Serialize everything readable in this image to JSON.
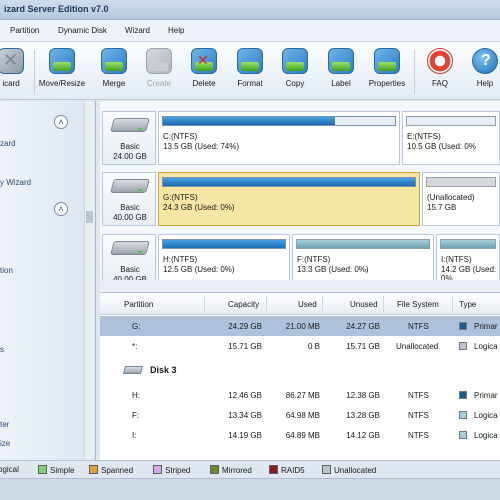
{
  "window": {
    "title": "izard Server Edition v7.0"
  },
  "menu": [
    "Partition",
    "Dynamic Disk",
    "Wizard",
    "Help"
  ],
  "toolbar": {
    "items": [
      {
        "label": "icard",
        "icon": "undo-icon",
        "enabled": true
      },
      {
        "label": "Move/Resize",
        "icon": "move-resize-icon",
        "enabled": true
      },
      {
        "label": "Merge",
        "icon": "merge-icon",
        "enabled": true
      },
      {
        "label": "Create",
        "icon": "create-icon",
        "enabled": false
      },
      {
        "label": "Delete",
        "icon": "delete-icon",
        "enabled": true
      },
      {
        "label": "Format",
        "icon": "format-icon",
        "enabled": true
      },
      {
        "label": "Copy",
        "icon": "copy-icon",
        "enabled": true
      },
      {
        "label": "Label",
        "icon": "label-icon",
        "enabled": true
      },
      {
        "label": "Properties",
        "icon": "properties-icon",
        "enabled": true
      },
      {
        "label": "FAQ",
        "icon": "lifebuoy-icon",
        "enabled": true
      },
      {
        "label": "Help",
        "icon": "help-icon",
        "enabled": true
      }
    ]
  },
  "sidebar": {
    "items": [
      "zard",
      "y Wizard",
      "tion",
      "s",
      "ter",
      "ize"
    ]
  },
  "disks": [
    {
      "type": "Basic",
      "size": "24.00 GB",
      "partitions": [
        {
          "name": "C:(NTFS)",
          "detail": "13.5 GB (Used: 74%)",
          "kind": "primary",
          "fill": 74
        },
        {
          "name": "E:(NTFS)",
          "detail": "10.5 GB (Used: 0%",
          "kind": "logical",
          "fill": 0
        }
      ]
    },
    {
      "type": "Basic",
      "size": "40.00 GB",
      "partitions": [
        {
          "name": "G:(NTFS)",
          "detail": "24.3 GB (Used: 0%)",
          "kind": "primary",
          "fill": 100,
          "selected": true
        },
        {
          "name": "(Unallocated)",
          "detail": "15.7 GB",
          "kind": "unallocated",
          "fill": 0
        }
      ]
    },
    {
      "type": "Basic",
      "size": "40.00 GB",
      "partitions": [
        {
          "name": "H:(NTFS)",
          "detail": "12.5 GB (Used: 0%)",
          "kind": "primary",
          "fill": 100
        },
        {
          "name": "F:(NTFS)",
          "detail": "13.3 GB (Used: 0%)",
          "kind": "logical",
          "fill": 100
        },
        {
          "name": "I:(NTFS)",
          "detail": "14.2 GB (Used: 0%",
          "kind": "logical",
          "fill": 100
        }
      ]
    }
  ],
  "table": {
    "headers": [
      "Partition",
      "Capacity",
      "Used",
      "Unused",
      "File System",
      "Type"
    ],
    "rows": [
      {
        "partition": "G:",
        "capacity": "24.29 GB",
        "used": "21.00 MB",
        "unused": "24.27 GB",
        "fs": "NTFS",
        "type": "Primar",
        "kind": "prim",
        "selected": true
      },
      {
        "partition": "*:",
        "capacity": "15.71 GB",
        "used": "0 B",
        "unused": "15.71 GB",
        "fs": "Unallocated",
        "type": "Logica",
        "kind": "unal"
      }
    ],
    "disk3_label": "Disk 3",
    "rows3": [
      {
        "partition": "H:",
        "capacity": "12.46 GB",
        "used": "86.27 MB",
        "unused": "12.38 GB",
        "fs": "NTFS",
        "type": "Primar",
        "kind": "prim"
      },
      {
        "partition": "F:",
        "capacity": "13.34 GB",
        "used": "64.98 MB",
        "unused": "13.28 GB",
        "fs": "NTFS",
        "type": "Logica",
        "kind": "logi"
      },
      {
        "partition": "I:",
        "capacity": "14.19 GB",
        "used": "64.89 MB",
        "unused": "14.12 GB",
        "fs": "NTFS",
        "type": "Logica",
        "kind": "logi"
      }
    ]
  },
  "legend": [
    {
      "label": "ogical",
      "color": ""
    },
    {
      "label": "Simple",
      "color": "#7fd36a"
    },
    {
      "label": "Spanned",
      "color": "#e7a03a"
    },
    {
      "label": "Striped",
      "color": "#d8a8e8"
    },
    {
      "label": "Mirrored",
      "color": "#6f8a2a"
    },
    {
      "label": "RAID5",
      "color": "#8c1a1a"
    },
    {
      "label": "Unallocated",
      "color": "#bfc4c9"
    }
  ]
}
